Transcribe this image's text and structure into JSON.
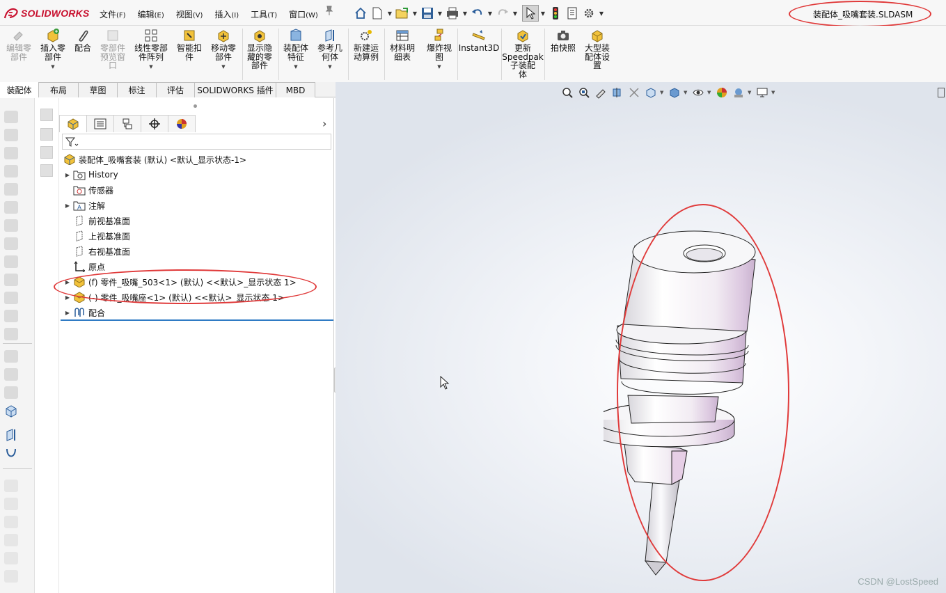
{
  "app": {
    "brand": "SOLIDWORKS",
    "document_title": "装配体_吸嘴套装.SLDASM",
    "accent": "#c8102e",
    "annotation_color": "#e03a3a"
  },
  "menu": [
    {
      "label": "文件",
      "key": "(F)"
    },
    {
      "label": "编辑",
      "key": "(E)"
    },
    {
      "label": "视图",
      "key": "(V)"
    },
    {
      "label": "插入",
      "key": "(I)"
    },
    {
      "label": "工具",
      "key": "(T)"
    },
    {
      "label": "窗口",
      "key": "(W)"
    }
  ],
  "ribbon": {
    "buttons": [
      {
        "label": "编辑零\n部件",
        "disabled": true
      },
      {
        "label": "插入零\n部件",
        "disabled": false
      },
      {
        "label": "配合",
        "disabled": false
      },
      {
        "label": "零部件\n预览窗\n口",
        "disabled": true
      },
      {
        "label": "线性零部\n件阵列",
        "disabled": false
      },
      {
        "label": "智能扣\n件",
        "disabled": false
      },
      {
        "label": "移动零\n部件",
        "disabled": false
      },
      {
        "label": "显示隐\n藏的零\n部件",
        "disabled": false
      },
      {
        "label": "装配体\n特征",
        "disabled": false
      },
      {
        "label": "参考几\n何体",
        "disabled": false
      },
      {
        "label": "新建运\n动算例",
        "disabled": false
      },
      {
        "label": "材料明\n细表",
        "disabled": false
      },
      {
        "label": "爆炸视\n图",
        "disabled": false
      },
      {
        "label": "Instant3D",
        "disabled": false
      },
      {
        "label": "更新\nSpeedpak\n子装配\n体",
        "disabled": false
      },
      {
        "label": "拍快照",
        "disabled": false
      },
      {
        "label": "大型装\n配体设\n置",
        "disabled": false
      }
    ]
  },
  "tabs": [
    "装配体",
    "布局",
    "草图",
    "标注",
    "评估",
    "SOLIDWORKS 插件",
    "MBD"
  ],
  "tree": {
    "root": "装配体_吸嘴套装 (默认) <默认_显示状态-1>",
    "items": [
      {
        "label": "History",
        "icon": "history-folder-icon",
        "expand": true
      },
      {
        "label": "传感器",
        "icon": "sensor-icon",
        "expand": false
      },
      {
        "label": "注解",
        "icon": "annotation-icon",
        "expand": true
      },
      {
        "label": "前视基准面",
        "icon": "plane-icon",
        "expand": false
      },
      {
        "label": "上视基准面",
        "icon": "plane-icon",
        "expand": false
      },
      {
        "label": "右视基准面",
        "icon": "plane-icon",
        "expand": false
      },
      {
        "label": "原点",
        "icon": "origin-icon",
        "expand": false
      },
      {
        "label": "(f) 零件_吸嘴_503<1> (默认) <<默认>_显示状态 1>",
        "icon": "part-icon",
        "expand": true
      },
      {
        "label": "(-) 零件_吸嘴座<1> (默认) <<默认>_显示状态 1>",
        "icon": "part-icon",
        "expand": true
      },
      {
        "label": "配合",
        "icon": "mates-icon",
        "expand": true
      }
    ]
  },
  "watermark": "CSDN @LostSpeed"
}
